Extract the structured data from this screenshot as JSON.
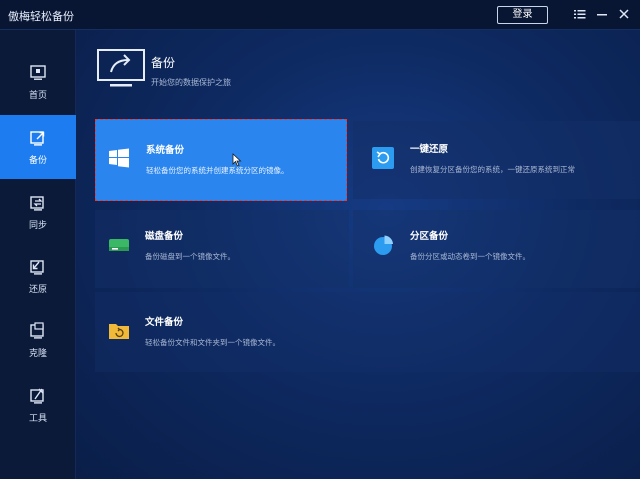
{
  "app": {
    "title": "傲梅轻松备份"
  },
  "titlebar": {
    "login_label": "登录",
    "icons": [
      "menu-icon",
      "minimize-icon",
      "close-icon"
    ]
  },
  "sidebar": {
    "items": [
      {
        "label": "首页",
        "icon": "home-icon",
        "active": false
      },
      {
        "label": "备份",
        "icon": "backup-icon",
        "active": true
      },
      {
        "label": "同步",
        "icon": "sync-icon",
        "active": false
      },
      {
        "label": "还原",
        "icon": "restore-icon",
        "active": false
      },
      {
        "label": "克隆",
        "icon": "clone-icon",
        "active": false
      },
      {
        "label": "工具",
        "icon": "tools-icon",
        "active": false
      }
    ]
  },
  "header": {
    "title": "备份",
    "subtitle": "开始您的数据保护之旅"
  },
  "cards": {
    "system_backup": {
      "title": "系统备份",
      "desc": "轻松备份您的系统并创建系统分区的镜像。"
    },
    "one_click_restore": {
      "title": "一键还原",
      "desc": "创建恢复分区备份您的系统，一键还原系统到正常"
    },
    "disk_backup": {
      "title": "磁盘备份",
      "desc": "备份磁盘到一个镜像文件。"
    },
    "partition_backup": {
      "title": "分区备份",
      "desc": "备份分区或动态卷到一个镜像文件。"
    },
    "file_backup": {
      "title": "文件备份",
      "desc": "轻松备份文件和文件夹到一个镜像文件。"
    }
  },
  "colors": {
    "accent": "#1c7cf0",
    "selected_card": "#2a86ee",
    "selection_border": "#e43b3b",
    "disk_icon": "#3bb866",
    "restore_icon": "#2c9cf0",
    "file_icon": "#f0b93a"
  }
}
